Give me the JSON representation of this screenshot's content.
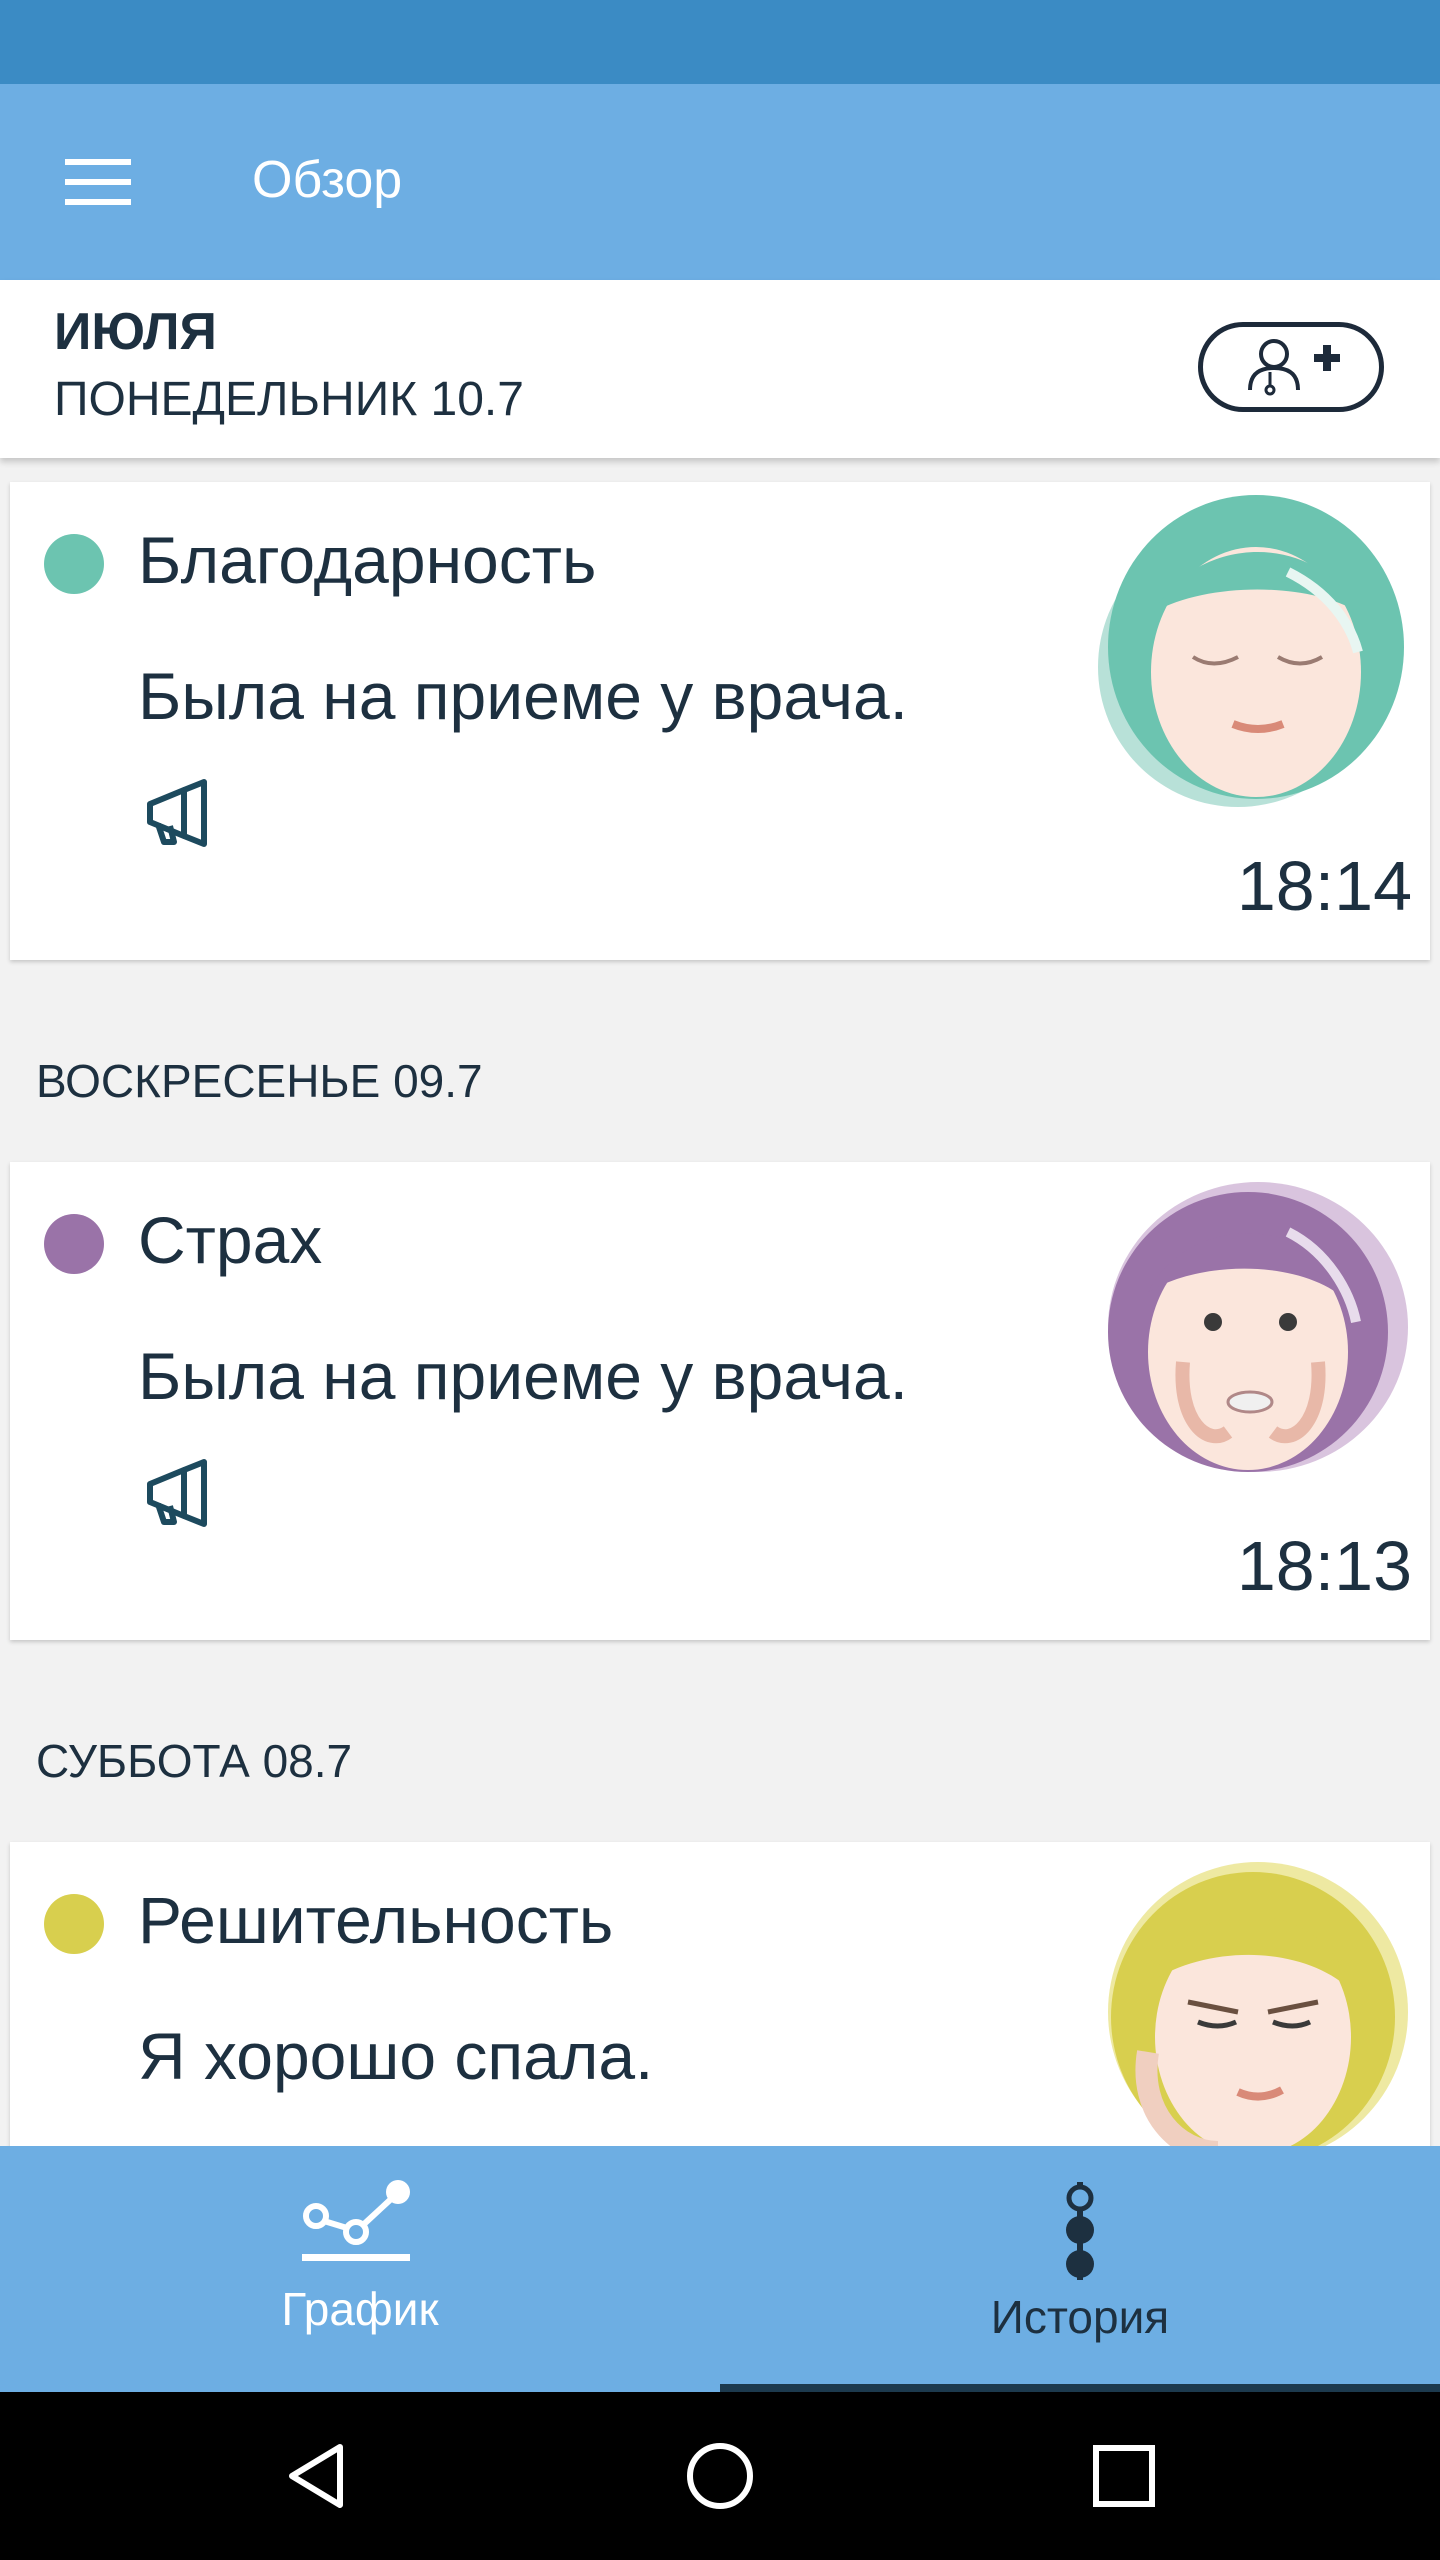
{
  "app_bar": {
    "title": "Обзор"
  },
  "header": {
    "month": "ИЮЛЯ",
    "current_day": "ПОНЕДЕЛЬНИК 10.7"
  },
  "entries": [
    {
      "emotion": "Благодарность",
      "note": "Была на приеме у врача.",
      "time": "18:14",
      "color": "#6cc4b0"
    },
    {
      "emotion": "Страх",
      "note": "Была на приеме у врача.",
      "time": "18:13",
      "color": "#9a73a8"
    },
    {
      "emotion": "Решительность",
      "note": "Я хорошо спала.",
      "color": "#d8cf4e"
    }
  ],
  "day_labels": [
    "ВОСКРЕСЕНЬЕ 09.7",
    "СУББОТА 08.7"
  ],
  "bottom_nav": {
    "tabs": [
      {
        "label": "График",
        "icon": "graph-icon",
        "active": false
      },
      {
        "label": "История",
        "icon": "timeline-icon",
        "active": true
      }
    ]
  },
  "icons": {
    "menu": "hamburger-icon",
    "add_contact": "add-person-icon",
    "share": "megaphone-icon",
    "system": [
      "back-icon",
      "home-icon",
      "recents-icon"
    ]
  },
  "colors": {
    "status_bar": "#3b8bc4",
    "app_bar": "#6daee3",
    "text_dark": "#1d3040",
    "background": "#f2f2f2"
  }
}
